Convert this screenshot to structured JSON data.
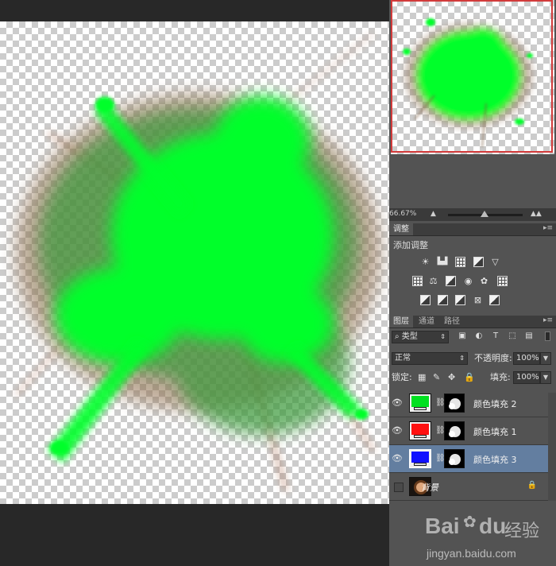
{
  "navigator": {
    "zoom_text": "66.67%",
    "viewbox_color": "#d23b3b"
  },
  "adjustments_panel": {
    "tab_label": "调整",
    "title": "添加调整",
    "icons": [
      "brightness-contrast-icon",
      "levels-icon",
      "curves-icon",
      "exposure-icon",
      "vibrance-icon",
      "hue-saturation-icon",
      "color-balance-icon",
      "black-white-icon",
      "photo-filter-icon",
      "channel-mixer-icon",
      "color-lookup-icon",
      "invert-icon",
      "posterize-icon",
      "threshold-icon",
      "selective-color-icon",
      "gradient-map-icon"
    ]
  },
  "layers_panel": {
    "tabs": [
      "图层",
      "通道",
      "路径"
    ],
    "filter_kind": "类型",
    "blend_mode": "正常",
    "opacity_label": "不透明度:",
    "opacity_value": "100%",
    "lock_label": "锁定:",
    "fill_label": "填充:",
    "fill_value": "100%",
    "layers": [
      {
        "name": "颜色填充 2",
        "color": "#00e020",
        "selected": false
      },
      {
        "name": "颜色填充 1",
        "color": "#ff1010",
        "selected": false
      },
      {
        "name": "颜色填充 3",
        "color": "#1010ff",
        "selected": true
      },
      {
        "name": "背景",
        "locked": true,
        "visible": false
      }
    ]
  },
  "canvas": {
    "splash_color": "#00ff2a",
    "trail_color": "#a0522d"
  },
  "watermark": {
    "logo_text": "Bai",
    "logo_text_2": "du",
    "brand_text": "经验",
    "url": "jingyan.baidu.com"
  }
}
